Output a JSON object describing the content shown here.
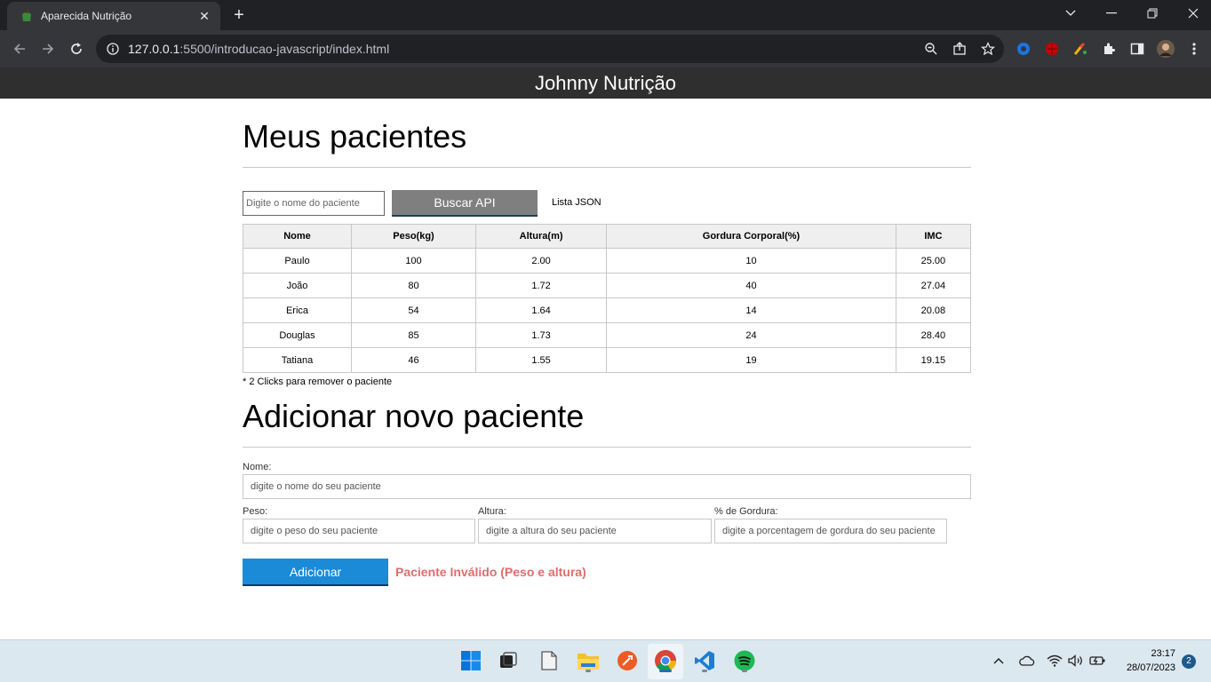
{
  "browser": {
    "tab_title": "Aparecida Nutrição",
    "tab_close": "✕",
    "new_tab": "+",
    "url_host": "127.0.0.1",
    "url_rest": ":5500/introducao-javascript/index.html"
  },
  "site": {
    "header_title": "Johnny Nutrição"
  },
  "patients": {
    "heading": "Meus pacientes",
    "search_placeholder": "Digite o nome do paciente",
    "api_button": "Buscar API",
    "json_link": "Lista JSON",
    "columns": [
      "Nome",
      "Peso(kg)",
      "Altura(m)",
      "Gordura Corporal(%)",
      "IMC"
    ],
    "rows": [
      [
        "Paulo",
        "100",
        "2.00",
        "10",
        "25.00"
      ],
      [
        "João",
        "80",
        "1.72",
        "40",
        "27.04"
      ],
      [
        "Erica",
        "54",
        "1.64",
        "14",
        "20.08"
      ],
      [
        "Douglas",
        "85",
        "1.73",
        "24",
        "28.40"
      ],
      [
        "Tatiana",
        "46",
        "1.55",
        "19",
        "19.15"
      ]
    ],
    "note": "* 2 Clicks para remover o paciente"
  },
  "form": {
    "heading": "Adicionar novo paciente",
    "name_label": "Nome:",
    "name_placeholder": "digite o nome do seu paciente",
    "weight_label": "Peso:",
    "weight_placeholder": "digite o peso do seu paciente",
    "height_label": "Altura:",
    "height_placeholder": "digite a altura do seu paciente",
    "fat_label": "% de Gordura:",
    "fat_placeholder": "digite a porcentagem de gordura do seu paciente",
    "add_button": "Adicionar",
    "error_message": "Paciente Inválido (Peso e altura)"
  },
  "taskbar": {
    "time": "23:17",
    "date": "28/07/2023",
    "notifications": "2"
  },
  "colors": {
    "header_bg": "#2f2f2f",
    "api_button": "#7f7f7f",
    "add_button": "#1b8bd7",
    "error": "#e06c6c"
  }
}
